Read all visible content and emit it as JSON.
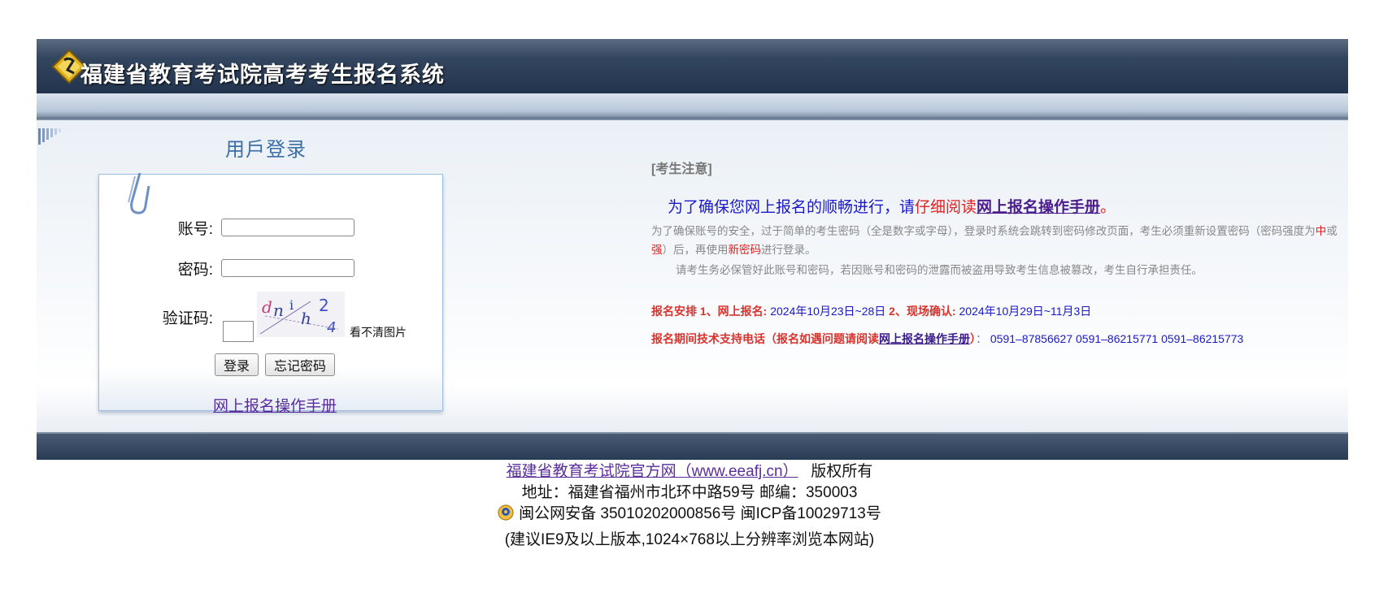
{
  "header": {
    "system_title": "福建省教育考试院高考考生报名系统",
    "logo_icon": "diamond-logo-icon"
  },
  "login": {
    "title": "用戶登录",
    "account_label": "账号:",
    "account_value": "",
    "password_label": "密码:",
    "password_value": "",
    "captcha_label": "验证码:",
    "captcha_text": "dn ih 2 4",
    "captcha_value": "",
    "captcha_refresh": "看不清图片",
    "login_button": "登录",
    "forgot_button": "忘记密码",
    "manual_link": "网上报名操作手册"
  },
  "notice": {
    "heading": "[考生注意]",
    "intro_part1": "为了确保您网上报名的顺畅进行，请",
    "intro_part2": "仔细阅读",
    "intro_link": "网上报名操作手册",
    "intro_end": "。",
    "p1_part1": "为了确保账号的安全，过于简单的考生密码（全是数字或字母），登录时系统会跳转到密码修改页面，考生必须重新设置密码（密码强度为",
    "p1_mid": "中",
    "p1_or": "或",
    "p1_strong": "强",
    "p1_part2": "）后，再使用",
    "p1_newpwd": "新密码",
    "p1_part3": "进行登录。",
    "p2": "请考生务必保管好此账号和密码，若因账号和密码的泄露而被盗用导致考生信息被篡改，考生自行承担责任。",
    "schedule_label": "报名安排 1、网上报名:",
    "schedule_online": " 2024年10月23日~28日 ",
    "schedule_label2": "2、现场确认:",
    "schedule_confirm": " 2024年10月29日~11月3日",
    "support_label": "报名期间技术支持电话（报名如遇问题请阅读",
    "support_link": "网上报名操作手册",
    "support_close": "）",
    "support_colon": "：",
    "support_phones": " 0591–87856627    0591–86215771    0591–86215773"
  },
  "footer": {
    "official_site": "福建省教育考试院官方网（www.eeafj.cn）",
    "copyright": "   版权所有",
    "address": "地址：福建省福州市北环中路59号 邮编：350003",
    "icp": "闽公网安备 35010202000856号  闽ICP备10029713号",
    "browser_tip": "(建议IE9及以上版本,1024×768以上分辨率浏览本网站)"
  },
  "colors": {
    "header_dark": "#22344d",
    "link_purple": "#5a2d9c",
    "notice_blue": "#1a18c8",
    "notice_red": "#e02020",
    "title_blue": "#3b6fa6"
  }
}
